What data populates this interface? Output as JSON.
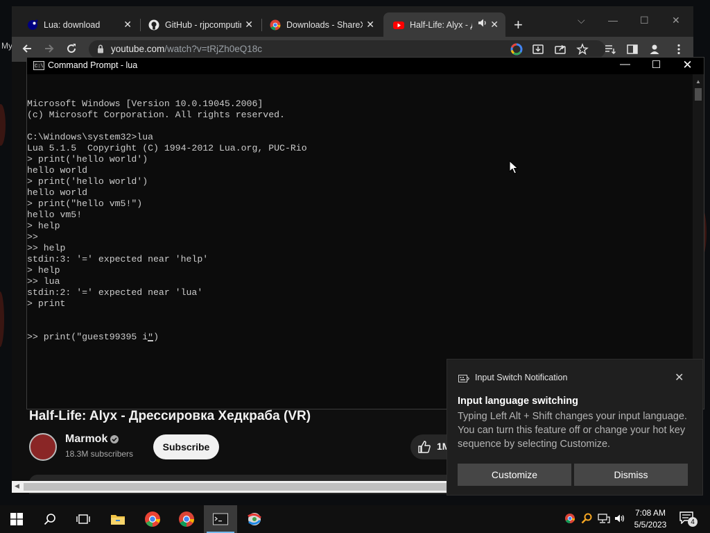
{
  "desktop": {
    "fragment_text": "My"
  },
  "browser": {
    "tabs": [
      {
        "label": "Lua: download",
        "icon": "lua-icon",
        "active": false
      },
      {
        "label": "GitHub - rjpcomputing",
        "icon": "github-icon",
        "active": false
      },
      {
        "label": "Downloads - ShareX",
        "icon": "chrome-icon",
        "active": false
      },
      {
        "label": "Half-Life: Alyx - Дрессировка",
        "icon": "youtube-icon",
        "active": true
      }
    ],
    "url_host": "youtube.com",
    "url_path": "/watch?v=tRjZh0eQ18c"
  },
  "youtube": {
    "video_title": "Half-Life: Alyx - Дрессировка Хедкраба (VR)",
    "channel_name": "Marmok",
    "subscribers": "18.3M subscribers",
    "subscribe_label": "Subscribe",
    "like_count": "1M"
  },
  "cmd": {
    "title": "Command Prompt - lua",
    "lines": [
      "Microsoft Windows [Version 10.0.19045.2006]",
      "(c) Microsoft Corporation. All rights reserved.",
      "",
      "C:\\Windows\\system32>lua",
      "Lua 5.1.5  Copyright (C) 1994-2012 Lua.org, PUC-Rio",
      "> print('hello world')",
      "hello world",
      "> print('hello world')",
      "hello world",
      "> print(\"hello vm5!\")",
      "hello vm5!",
      "> help",
      ">>",
      ">> help",
      "stdin:3: '=' expected near 'help'",
      "> help",
      ">> lua",
      "stdin:2: '=' expected near 'lua'",
      "> print"
    ],
    "current_input_before": ">> print(\"guest99395 i",
    "current_input_cursor_char": "\"",
    "current_input_after": ")"
  },
  "notification": {
    "app": "Input Switch Notification",
    "heading": "Input language switching",
    "body": "Typing Left Alt + Shift changes your input language. You can turn this feature off or change your hot key sequence by selecting Customize.",
    "customize_label": "Customize",
    "dismiss_label": "Dismiss"
  },
  "taskbar": {
    "time": "7:08 AM",
    "date": "5/5/2023",
    "notification_count": "4"
  }
}
